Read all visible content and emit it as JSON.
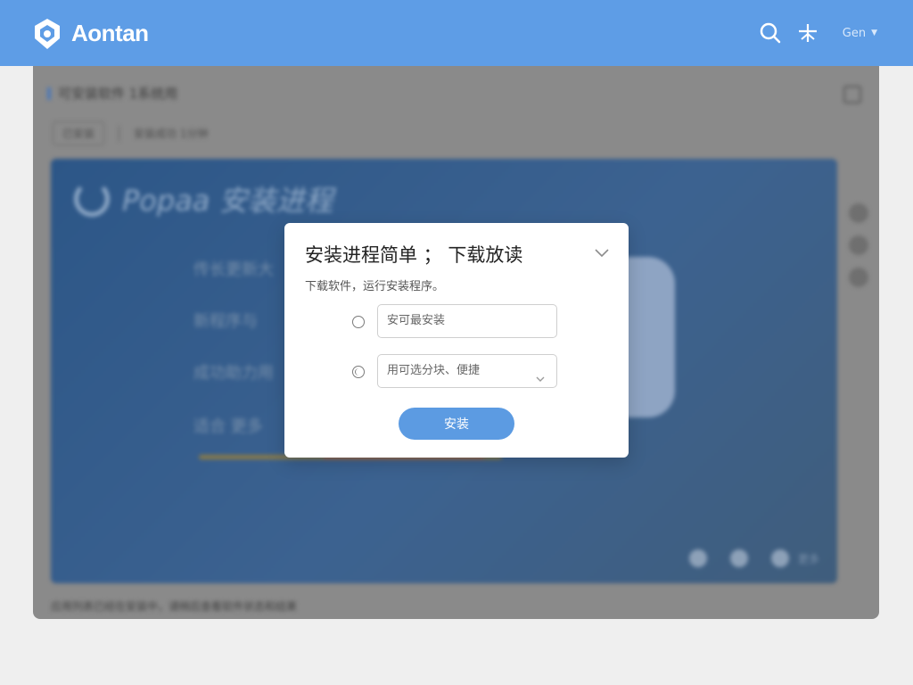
{
  "header": {
    "app_name": "Aontan",
    "user_label": "Gen",
    "icons": [
      "logo-icon",
      "search-icon",
      "plane-icon",
      "chevron-down-icon"
    ]
  },
  "background": {
    "title": "可安装软件 1系统用",
    "tab_label": "已安装",
    "tab_value": "安装成功 1分钟",
    "banner_title": "Popaa 安装进程",
    "lines": [
      "传长更新大",
      "新程序与",
      "成功助力用",
      "适合 更多"
    ],
    "dots_label": "更多",
    "footer": "应用列表已经在安装中，请稍后查看软件状态和结果"
  },
  "modal": {
    "title": "安装进程简单 ；  下载放读",
    "subtitle": "下载软件，运行安装程序。",
    "option1_value": "安可最安装",
    "option2_value": "用可选分块、便捷",
    "install_label": "安装"
  },
  "colors": {
    "header_bg": "#5e9de6",
    "button_bg": "#5c9be2",
    "banner_bg": "#2c5687"
  }
}
